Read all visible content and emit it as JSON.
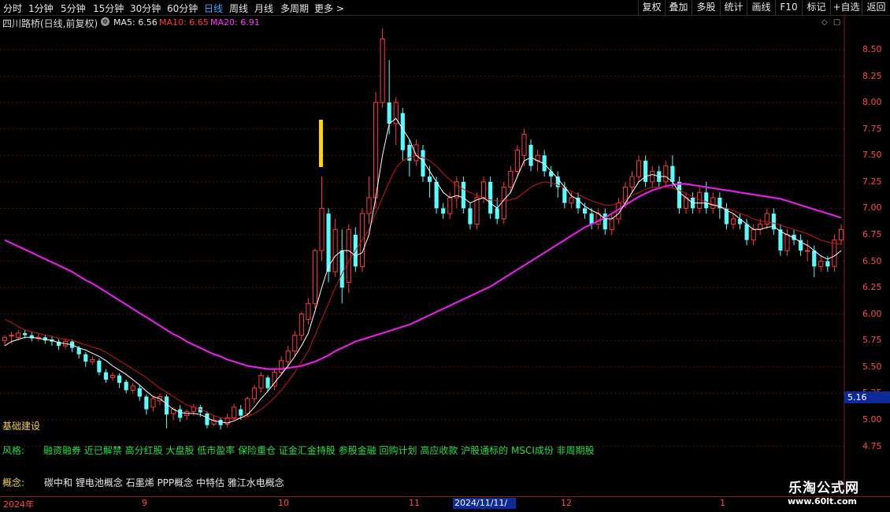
{
  "periods": [
    "分时",
    "1分钟",
    "5分钟",
    "15分钟",
    "30分钟",
    "60分钟",
    "日线",
    "周线",
    "月线",
    "多周期",
    "更多"
  ],
  "active_period": "日线",
  "more_arrow": ">",
  "toolbar": [
    "复权",
    "叠加",
    "多股",
    "统计",
    "画线",
    "F10",
    "标记",
    "+自选",
    "返回"
  ],
  "stock": {
    "title": "四川路桥(日线,前复权)",
    "ma5_label": "MA5: 6.56",
    "ma10_label": "MA10: 6.65",
    "ma20_label": "MA20: 6.91"
  },
  "colors": {
    "up": "#ff3b3b",
    "down": "#54ffff",
    "ma5": "#ffffff",
    "ma10": "#d01515",
    "ma20": "#e020e0",
    "marker": "#ffd400"
  },
  "yaxis": {
    "ticks": [
      "8.50",
      "8.25",
      "8.00",
      "7.75",
      "7.50",
      "7.25",
      "7.00",
      "6.75",
      "6.50",
      "6.25",
      "6.00",
      "5.75",
      "5.50",
      "5.25",
      "5.00",
      "4.75"
    ],
    "highlight": "5.16"
  },
  "xaxis": {
    "labels": [
      "2024年",
      "9",
      "10",
      "11",
      "12",
      "1"
    ],
    "selected": "2024/11/11/—"
  },
  "info": {
    "industry": "基础建设",
    "style_label": "风格:",
    "style_text": "融资融券 近已解禁 高分红股 大盘股 低市盈率 保险重仓 证金汇金持股 参股金融 回购计划 高应收款 沪股通标的 MSCI成份 非周期股",
    "concept_label": "概念:",
    "concept_text": "碳中和 锂电池概念 石墨烯 PPP概念 中特估 雅江水电概念"
  },
  "watermark": {
    "title": "乐淘公式网",
    "url": "www.60lt.com"
  },
  "chart_data": {
    "type": "candlestick",
    "ylim": [
      4.7,
      8.7
    ],
    "candles": [
      [
        5.75,
        5.78,
        5.7,
        5.8
      ],
      [
        5.8,
        5.8,
        5.72,
        5.83
      ],
      [
        5.78,
        5.82,
        5.75,
        5.85
      ],
      [
        5.82,
        5.8,
        5.77,
        5.85
      ],
      [
        5.8,
        5.77,
        5.74,
        5.83
      ],
      [
        5.78,
        5.78,
        5.74,
        5.82
      ],
      [
        5.78,
        5.75,
        5.72,
        5.8
      ],
      [
        5.76,
        5.74,
        5.7,
        5.79
      ],
      [
        5.74,
        5.7,
        5.66,
        5.76
      ],
      [
        5.7,
        5.74,
        5.67,
        5.77
      ],
      [
        5.74,
        5.68,
        5.64,
        5.76
      ],
      [
        5.68,
        5.62,
        5.58,
        5.7
      ],
      [
        5.62,
        5.55,
        5.5,
        5.64
      ],
      [
        5.55,
        5.57,
        5.52,
        5.6
      ],
      [
        5.56,
        5.45,
        5.42,
        5.58
      ],
      [
        5.45,
        5.38,
        5.35,
        5.48
      ],
      [
        5.4,
        5.42,
        5.37,
        5.45
      ],
      [
        5.42,
        5.35,
        5.3,
        5.44
      ],
      [
        5.36,
        5.28,
        5.25,
        5.38
      ],
      [
        5.28,
        5.32,
        5.25,
        5.35
      ],
      [
        5.3,
        5.22,
        5.18,
        5.33
      ],
      [
        5.22,
        5.1,
        5.05,
        5.24
      ],
      [
        5.12,
        5.2,
        5.08,
        5.22
      ],
      [
        5.18,
        5.22,
        5.14,
        5.25
      ],
      [
        5.22,
        5.05,
        4.92,
        5.24
      ],
      [
        5.06,
        5.1,
        5.0,
        5.12
      ],
      [
        5.1,
        5.02,
        4.98,
        5.14
      ],
      [
        5.04,
        5.08,
        5.0,
        5.1
      ],
      [
        5.08,
        5.12,
        5.04,
        5.15
      ],
      [
        5.12,
        5.07,
        5.03,
        5.14
      ],
      [
        5.06,
        4.95,
        4.92,
        5.08
      ],
      [
        4.96,
        5.0,
        4.94,
        5.04
      ],
      [
        5.0,
        4.95,
        4.91,
        5.02
      ],
      [
        4.96,
        5.02,
        4.93,
        5.06
      ],
      [
        5.02,
        5.12,
        5.0,
        5.15
      ],
      [
        5.1,
        5.04,
        5.0,
        5.14
      ],
      [
        5.06,
        5.2,
        5.03,
        5.22
      ],
      [
        5.2,
        5.3,
        5.16,
        5.33
      ],
      [
        5.3,
        5.42,
        5.26,
        5.45
      ],
      [
        5.4,
        5.3,
        5.26,
        5.42
      ],
      [
        5.32,
        5.45,
        5.28,
        5.48
      ],
      [
        5.45,
        5.56,
        5.42,
        5.6
      ],
      [
        5.55,
        5.65,
        5.5,
        5.7
      ],
      [
        5.65,
        5.8,
        5.6,
        5.84
      ],
      [
        5.8,
        6.0,
        5.75,
        6.02
      ],
      [
        5.95,
        6.1,
        5.9,
        6.15
      ],
      [
        6.1,
        6.6,
        6.05,
        6.62
      ],
      [
        6.6,
        7.0,
        6.5,
        7.3
      ],
      [
        6.95,
        6.4,
        6.3,
        7.0
      ],
      [
        6.4,
        6.8,
        6.35,
        6.9
      ],
      [
        6.6,
        6.25,
        6.1,
        6.8
      ],
      [
        6.3,
        6.8,
        6.2,
        6.85
      ],
      [
        6.75,
        6.45,
        6.4,
        6.82
      ],
      [
        6.45,
        6.95,
        6.4,
        7.0
      ],
      [
        6.95,
        7.1,
        6.85,
        7.3
      ],
      [
        7.1,
        8.0,
        7.0,
        8.1
      ],
      [
        8.0,
        8.6,
        7.95,
        8.7
      ],
      [
        8.0,
        7.8,
        7.7,
        8.4
      ],
      [
        7.8,
        8.0,
        7.6,
        8.05
      ],
      [
        7.9,
        7.55,
        7.45,
        7.95
      ],
      [
        7.6,
        7.45,
        7.3,
        7.65
      ],
      [
        7.45,
        7.6,
        7.4,
        7.65
      ],
      [
        7.55,
        7.3,
        7.25,
        7.6
      ],
      [
        7.3,
        7.25,
        7.1,
        7.4
      ],
      [
        7.25,
        7.0,
        6.95,
        7.3
      ],
      [
        7.0,
        6.95,
        6.9,
        7.05
      ],
      [
        6.95,
        7.1,
        6.9,
        7.15
      ],
      [
        7.1,
        7.25,
        7.0,
        7.3
      ],
      [
        7.25,
        7.0,
        6.95,
        7.3
      ],
      [
        7.0,
        6.85,
        6.8,
        7.05
      ],
      [
        6.85,
        7.1,
        6.8,
        7.15
      ],
      [
        7.1,
        7.25,
        7.05,
        7.3
      ],
      [
        7.25,
        6.95,
        6.9,
        7.3
      ],
      [
        7.0,
        6.9,
        6.85,
        7.1
      ],
      [
        6.9,
        7.2,
        6.85,
        7.25
      ],
      [
        7.2,
        7.35,
        7.15,
        7.4
      ],
      [
        7.35,
        7.55,
        7.3,
        7.6
      ],
      [
        7.5,
        7.7,
        7.4,
        7.75
      ],
      [
        7.6,
        7.4,
        7.35,
        7.65
      ],
      [
        7.45,
        7.5,
        7.35,
        7.55
      ],
      [
        7.5,
        7.35,
        7.3,
        7.55
      ],
      [
        7.35,
        7.3,
        7.2,
        7.4
      ],
      [
        7.3,
        7.2,
        7.1,
        7.35
      ],
      [
        7.2,
        7.05,
        7.0,
        7.25
      ],
      [
        7.05,
        7.1,
        7.0,
        7.15
      ],
      [
        7.1,
        7.0,
        6.95,
        7.15
      ],
      [
        7.0,
        6.95,
        6.9,
        7.05
      ],
      [
        6.95,
        6.85,
        6.8,
        7.0
      ],
      [
        6.85,
        6.95,
        6.8,
        7.0
      ],
      [
        6.95,
        6.8,
        6.75,
        7.0
      ],
      [
        6.8,
        6.9,
        6.75,
        6.95
      ],
      [
        6.9,
        7.05,
        6.85,
        7.1
      ],
      [
        7.05,
        7.2,
        7.0,
        7.25
      ],
      [
        7.2,
        7.3,
        7.15,
        7.35
      ],
      [
        7.3,
        7.45,
        7.25,
        7.5
      ],
      [
        7.45,
        7.25,
        7.2,
        7.5
      ],
      [
        7.25,
        7.35,
        7.2,
        7.4
      ],
      [
        7.35,
        7.25,
        7.2,
        7.4
      ],
      [
        7.25,
        7.4,
        7.2,
        7.45
      ],
      [
        7.4,
        7.25,
        7.2,
        7.5
      ],
      [
        7.25,
        7.0,
        6.95,
        7.3
      ],
      [
        7.0,
        7.1,
        6.95,
        7.15
      ],
      [
        7.1,
        7.0,
        6.95,
        7.15
      ],
      [
        7.0,
        7.15,
        6.95,
        7.2
      ],
      [
        7.15,
        7.0,
        6.95,
        7.25
      ],
      [
        7.0,
        7.1,
        6.95,
        7.15
      ],
      [
        7.1,
        7.0,
        6.9,
        7.15
      ],
      [
        7.0,
        6.85,
        6.8,
        7.05
      ],
      [
        6.85,
        6.9,
        6.8,
        6.95
      ],
      [
        6.9,
        6.85,
        6.8,
        6.95
      ],
      [
        6.85,
        6.7,
        6.65,
        6.9
      ],
      [
        6.7,
        6.8,
        6.65,
        6.85
      ],
      [
        6.8,
        6.85,
        6.75,
        6.9
      ],
      [
        6.85,
        6.95,
        6.8,
        7.0
      ],
      [
        6.95,
        6.8,
        6.75,
        7.0
      ],
      [
        6.8,
        6.6,
        6.55,
        6.85
      ],
      [
        6.6,
        6.75,
        6.55,
        6.8
      ],
      [
        6.75,
        6.7,
        6.65,
        6.8
      ],
      [
        6.7,
        6.6,
        6.55,
        6.75
      ],
      [
        6.6,
        6.6,
        6.5,
        6.7
      ],
      [
        6.6,
        6.45,
        6.35,
        6.65
      ],
      [
        6.45,
        6.5,
        6.4,
        6.55
      ],
      [
        6.5,
        6.45,
        6.4,
        6.55
      ],
      [
        6.45,
        6.7,
        6.4,
        6.75
      ],
      [
        6.7,
        6.8,
        6.65,
        6.85
      ]
    ],
    "ma5": [
      5.7,
      5.74,
      5.76,
      5.78,
      5.78,
      5.77,
      5.76,
      5.75,
      5.73,
      5.72,
      5.71,
      5.68,
      5.66,
      5.63,
      5.6,
      5.56,
      5.51,
      5.47,
      5.43,
      5.38,
      5.33,
      5.27,
      5.22,
      5.2,
      5.15,
      5.1,
      5.07,
      5.06,
      5.06,
      5.05,
      5.02,
      4.99,
      4.98,
      4.97,
      4.99,
      5.02,
      5.05,
      5.12,
      5.2,
      5.27,
      5.35,
      5.43,
      5.51,
      5.6,
      5.7,
      5.82,
      6.03,
      6.25,
      6.45,
      6.55,
      6.6,
      6.6,
      6.55,
      6.58,
      6.75,
      7.1,
      7.5,
      7.8,
      7.85,
      7.75,
      7.65,
      7.5,
      7.45,
      7.35,
      7.25,
      7.15,
      7.1,
      7.12,
      7.1,
      7.05,
      7.08,
      7.1,
      7.05,
      7.0,
      7.08,
      7.15,
      7.3,
      7.45,
      7.48,
      7.45,
      7.42,
      7.35,
      7.28,
      7.2,
      7.12,
      7.08,
      7.02,
      6.98,
      6.95,
      6.9,
      6.9,
      6.95,
      7.05,
      7.15,
      7.25,
      7.3,
      7.32,
      7.3,
      7.3,
      7.25,
      7.15,
      7.1,
      7.05,
      7.05,
      7.05,
      7.03,
      7.02,
      6.98,
      6.95,
      6.9,
      6.85,
      6.8,
      6.8,
      6.82,
      6.83,
      6.78,
      6.75,
      6.72,
      6.68,
      6.65,
      6.6,
      6.55,
      6.52,
      6.55,
      6.6
    ],
    "ma10": [
      5.95,
      5.92,
      5.88,
      5.85,
      5.83,
      5.82,
      5.8,
      5.79,
      5.77,
      5.76,
      5.75,
      5.73,
      5.71,
      5.69,
      5.67,
      5.64,
      5.6,
      5.56,
      5.52,
      5.48,
      5.44,
      5.4,
      5.35,
      5.3,
      5.26,
      5.22,
      5.18,
      5.14,
      5.12,
      5.1,
      5.07,
      5.04,
      5.02,
      5.01,
      5.01,
      5.02,
      5.03,
      5.06,
      5.1,
      5.15,
      5.21,
      5.28,
      5.36,
      5.45,
      5.55,
      5.65,
      5.8,
      5.95,
      6.1,
      6.25,
      6.38,
      6.5,
      6.6,
      6.7,
      6.8,
      6.95,
      7.1,
      7.25,
      7.38,
      7.45,
      7.48,
      7.5,
      7.48,
      7.45,
      7.4,
      7.33,
      7.27,
      7.22,
      7.18,
      7.15,
      7.12,
      7.1,
      7.08,
      7.07,
      7.07,
      7.08,
      7.1,
      7.15,
      7.2,
      7.23,
      7.25,
      7.24,
      7.22,
      7.19,
      7.16,
      7.13,
      7.1,
      7.07,
      7.05,
      7.03,
      7.03,
      7.05,
      7.08,
      7.12,
      7.15,
      7.18,
      7.2,
      7.2,
      7.2,
      7.19,
      7.17,
      7.14,
      7.11,
      7.08,
      7.06,
      7.04,
      7.02,
      7.0,
      6.98,
      6.95,
      6.93,
      6.9,
      6.88,
      6.87,
      6.86,
      6.84,
      6.82,
      6.8,
      6.78,
      6.76,
      6.73,
      6.7,
      6.68,
      6.67,
      6.66
    ],
    "ma20": [
      6.7,
      6.67,
      6.64,
      6.61,
      6.58,
      6.55,
      6.52,
      6.49,
      6.46,
      6.43,
      6.4,
      6.36,
      6.32,
      6.29,
      6.25,
      6.21,
      6.17,
      6.13,
      6.09,
      6.05,
      6.01,
      5.97,
      5.93,
      5.89,
      5.85,
      5.81,
      5.78,
      5.74,
      5.71,
      5.68,
      5.65,
      5.62,
      5.6,
      5.57,
      5.55,
      5.53,
      5.51,
      5.5,
      5.49,
      5.48,
      5.48,
      5.48,
      5.49,
      5.5,
      5.51,
      5.53,
      5.55,
      5.58,
      5.61,
      5.65,
      5.68,
      5.71,
      5.74,
      5.76,
      5.78,
      5.8,
      5.82,
      5.84,
      5.86,
      5.88,
      5.9,
      5.93,
      5.96,
      5.99,
      6.02,
      6.05,
      6.08,
      6.11,
      6.14,
      6.17,
      6.2,
      6.23,
      6.26,
      6.3,
      6.34,
      6.38,
      6.42,
      6.46,
      6.5,
      6.54,
      6.58,
      6.62,
      6.66,
      6.7,
      6.74,
      6.78,
      6.82,
      6.85,
      6.88,
      6.91,
      6.95,
      6.99,
      7.03,
      7.07,
      7.11,
      7.14,
      7.17,
      7.19,
      7.21,
      7.22,
      7.23,
      7.23,
      7.22,
      7.21,
      7.2,
      7.19,
      7.18,
      7.17,
      7.16,
      7.15,
      7.14,
      7.13,
      7.12,
      7.11,
      7.1,
      7.09,
      7.07,
      7.05,
      7.03,
      7.01,
      6.99,
      6.97,
      6.95,
      6.93,
      6.91
    ]
  }
}
